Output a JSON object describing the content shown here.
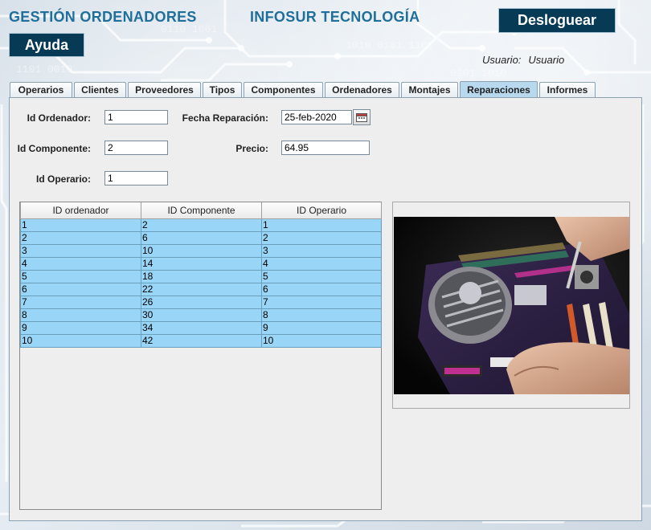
{
  "header": {
    "app_title": "GESTIÓN ORDENADORES",
    "company": "INFOSUR TECNOLOGÍA",
    "logout_label": "Desloguear",
    "help_label": "Ayuda",
    "user_label": "Usuario:",
    "user_name": "Usuario"
  },
  "tabs": [
    {
      "label": "Operarios"
    },
    {
      "label": "Clientes"
    },
    {
      "label": "Proveedores"
    },
    {
      "label": "Tipos"
    },
    {
      "label": "Componentes"
    },
    {
      "label": "Ordenadores"
    },
    {
      "label": "Montajes"
    },
    {
      "label": "Reparaciones",
      "active": true
    },
    {
      "label": "Informes"
    }
  ],
  "form": {
    "id_ordenador_label": "Id Ordenador:",
    "id_ordenador_value": "1",
    "fecha_label": "Fecha Reparación:",
    "fecha_value": "25-feb-2020",
    "id_componente_label": "Id Componente:",
    "id_componente_value": "2",
    "precio_label": "Precio:",
    "precio_value": "64.95",
    "id_operario_label": "Id Operario:",
    "id_operario_value": "1"
  },
  "table": {
    "columns": [
      "ID ordenador",
      "ID Componente",
      "ID Operario"
    ],
    "rows": [
      [
        "1",
        "2",
        "1"
      ],
      [
        "2",
        "6",
        "2"
      ],
      [
        "3",
        "10",
        "3"
      ],
      [
        "4",
        "14",
        "4"
      ],
      [
        "5",
        "18",
        "5"
      ],
      [
        "6",
        "22",
        "6"
      ],
      [
        "7",
        "26",
        "7"
      ],
      [
        "8",
        "30",
        "8"
      ],
      [
        "9",
        "34",
        "9"
      ],
      [
        "10",
        "42",
        "10"
      ]
    ]
  },
  "colors": {
    "brand_blue": "#1f6f9a",
    "button_dark": "#073a55",
    "row_highlight": "#98d5f6",
    "active_tab": "#b8d8ee"
  },
  "icons": {
    "calendar": "calendar-icon"
  }
}
